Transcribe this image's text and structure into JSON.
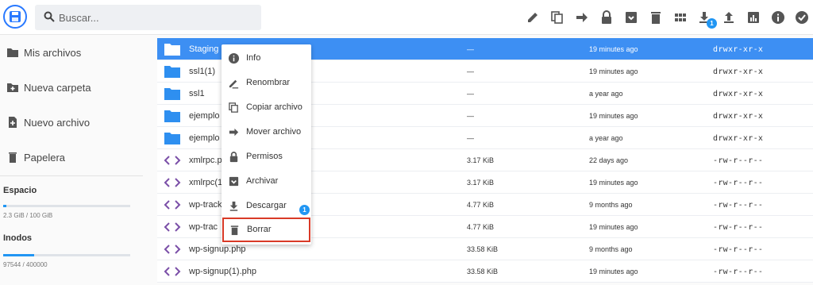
{
  "search": {
    "placeholder": "Buscar..."
  },
  "toolbar": {
    "icons": [
      "edit-icon",
      "copy-icon",
      "move-icon",
      "lock-icon",
      "archive-icon",
      "delete-icon",
      "grid-view-icon",
      "download-icon",
      "upload-icon",
      "stats-icon",
      "info-icon",
      "check-circle-icon"
    ],
    "download_badge": "1"
  },
  "sidebar": {
    "items": [
      {
        "label": "Mis archivos",
        "icon": "folder-icon"
      },
      {
        "label": "Nueva carpeta",
        "icon": "new-folder-icon"
      },
      {
        "label": "Nuevo archivo",
        "icon": "new-file-icon"
      },
      {
        "label": "Papelera",
        "icon": "trash-icon"
      }
    ],
    "space": {
      "title": "Espacio",
      "usage": "2.3 GiB / 100 GiB",
      "fraction": 0.023
    },
    "inodes": {
      "title": "Inodos",
      "usage": "97544 / 400000",
      "fraction": 0.244
    }
  },
  "files": [
    {
      "name": "Staging",
      "size": "—",
      "modified": "19 minutes ago",
      "perms": "drwxr-xr-x",
      "type": "folder",
      "selected": true
    },
    {
      "name": "ssl1(1)",
      "size": "—",
      "modified": "19 minutes ago",
      "perms": "drwxr-xr-x",
      "type": "folder"
    },
    {
      "name": "ssl1",
      "size": "—",
      "modified": "a year ago",
      "perms": "drwxr-xr-x",
      "type": "folder"
    },
    {
      "name": "ejemplo",
      "size": "—",
      "modified": "19 minutes ago",
      "perms": "drwxr-xr-x",
      "type": "folder"
    },
    {
      "name": "ejemplo",
      "size": "—",
      "modified": "a year ago",
      "perms": "drwxr-xr-x",
      "type": "folder"
    },
    {
      "name": "xmlrpc.p",
      "size": "3.17 KiB",
      "modified": "22 days ago",
      "perms": "-rw-r--r--",
      "type": "code"
    },
    {
      "name": "xmlrpc(1",
      "size": "3.17 KiB",
      "modified": "19 minutes ago",
      "perms": "-rw-r--r--",
      "type": "code"
    },
    {
      "name": "wp-track",
      "size": "4.77 KiB",
      "modified": "9 months ago",
      "perms": "-rw-r--r--",
      "type": "code"
    },
    {
      "name": "wp-trac",
      "size": "4.77 KiB",
      "modified": "19 minutes ago",
      "perms": "-rw-r--r--",
      "type": "code"
    },
    {
      "name": "wp-signup.php",
      "size": "33.58 KiB",
      "modified": "9 months ago",
      "perms": "-rw-r--r--",
      "type": "code"
    },
    {
      "name": "wp-signup(1).php",
      "size": "33.58 KiB",
      "modified": "19 minutes ago",
      "perms": "-rw-r--r--",
      "type": "code"
    }
  ],
  "context_menu": {
    "items": [
      {
        "label": "Info",
        "icon": "info-icon"
      },
      {
        "label": "Renombrar",
        "icon": "rename-icon"
      },
      {
        "label": "Copiar archivo",
        "icon": "copy-icon"
      },
      {
        "label": "Mover archivo",
        "icon": "move-icon"
      },
      {
        "label": "Permisos",
        "icon": "lock-icon"
      },
      {
        "label": "Archivar",
        "icon": "archive-icon"
      },
      {
        "label": "Descargar",
        "icon": "download-icon"
      },
      {
        "label": "Borrar",
        "icon": "delete-icon",
        "highlighted": true
      }
    ],
    "download_badge": "1"
  },
  "colors": {
    "accent": "#2979ff",
    "selection": "#3d8ff3",
    "folder": "#2e8ff0",
    "code": "#7b4fa8",
    "highlight": "#d93a27"
  }
}
